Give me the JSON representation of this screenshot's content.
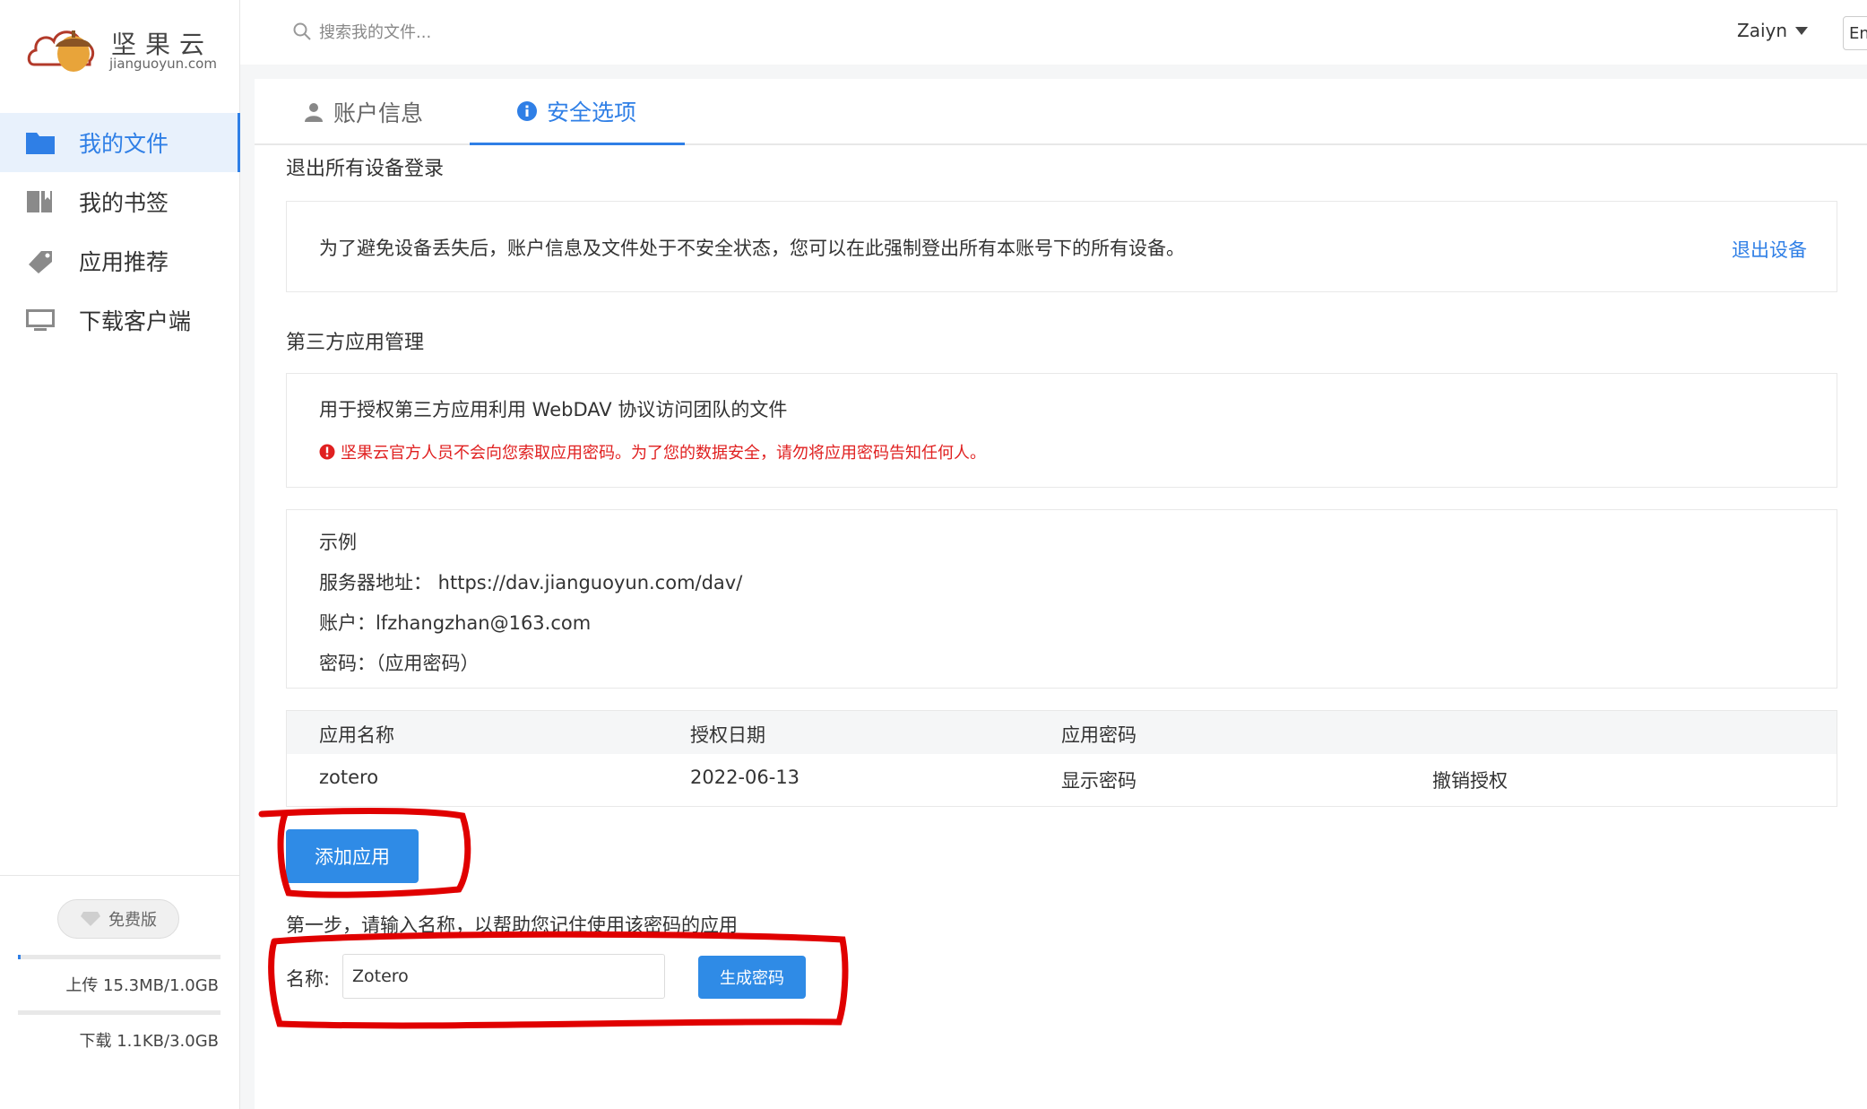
{
  "app": {
    "logo_title": "坚果云",
    "logo_sub": "jianguoyun.com"
  },
  "sidebar": {
    "items": [
      {
        "label": "我的文件",
        "icon": "folder-icon",
        "active": true
      },
      {
        "label": "我的书签",
        "icon": "bookmark-icon",
        "active": false
      },
      {
        "label": "应用推荐",
        "icon": "tag-icon",
        "active": false
      },
      {
        "label": "下载客户端",
        "icon": "monitor-icon",
        "active": false
      }
    ],
    "plan": "免费版",
    "upload": {
      "text": "上传 15.3MB/1.0GB",
      "fraction": 0.015
    },
    "download": {
      "text": "下载 1.1KB/3.0GB",
      "fraction": 0.0
    }
  },
  "header": {
    "search_placeholder": "搜索我的文件...",
    "user": "Zaiyn",
    "lang": "En"
  },
  "tabs": [
    {
      "label": "账户信息",
      "icon": "user-icon",
      "active": false
    },
    {
      "label": "安全选项",
      "icon": "info-icon",
      "active": true
    }
  ],
  "logout_section": {
    "title": "退出所有设备登录",
    "description": "为了避免设备丢失后，账户信息及文件处于不安全状态，您可以在此强制登出所有本账号下的所有设备。",
    "action": "退出设备"
  },
  "third_party": {
    "title": "第三方应用管理",
    "description": "用于授权第三方应用利用 WebDAV 协议访问团队的文件",
    "warning": "坚果云官方人员不会向您索取应用密码。为了您的数据安全，请勿将应用密码告知任何人。"
  },
  "example": {
    "title": "示例",
    "server": "服务器地址： https://dav.jianguoyun.com/dav/",
    "account": "账户：lfzhangzhan@163.com",
    "password": "密码：（应用密码）"
  },
  "table": {
    "headers": [
      "应用名称",
      "授权日期",
      "应用密码"
    ],
    "rows": [
      {
        "name": "zotero",
        "date": "2022-06-13",
        "show": "显示密码",
        "revoke": "撤销授权"
      }
    ]
  },
  "add_app_button": "添加应用",
  "step1": {
    "text": "第一步，请输入名称，以帮助您记住使用该密码的应用",
    "label": "名称:",
    "value": "Zotero",
    "button": "生成密码"
  },
  "colors": {
    "accent": "#2f7fe6",
    "warning": "#e02020",
    "annotation": "#e00000"
  }
}
